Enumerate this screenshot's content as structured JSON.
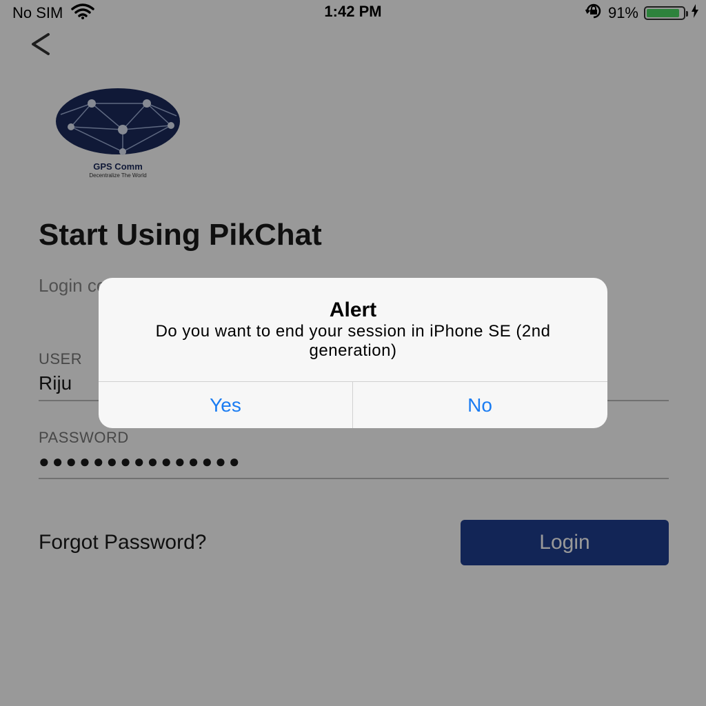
{
  "status_bar": {
    "carrier": "No SIM",
    "time": "1:42 PM",
    "battery_percent": "91%",
    "battery_level": 0.91,
    "battery_color": "#4cd964",
    "icons": [
      "wifi-icon",
      "rotation-lock-icon",
      "battery-icon",
      "charging-bolt-icon"
    ]
  },
  "nav": {
    "back_icon": "chevron-left-icon"
  },
  "logo": {
    "name": "GPS Comm",
    "tagline": "Decentralize The World",
    "icon": "globe-network-icon",
    "color": "#1b2a5c"
  },
  "page": {
    "title": "Start Using PikChat",
    "subtitle": "Login com"
  },
  "form": {
    "username_label": "USER",
    "username_value": "Riju",
    "password_label": "PASSWORD",
    "password_value": "●●●●●●●●●●●●●●●",
    "forgot_label": "Forgot Password?",
    "login_label": "Login",
    "login_color": "#1f3f8f"
  },
  "alert": {
    "title": "Alert",
    "message": "Do you want to end your session in iPhone SE (2nd generation)",
    "yes_label": "Yes",
    "no_label": "No",
    "button_color": "#1a7cf2"
  }
}
